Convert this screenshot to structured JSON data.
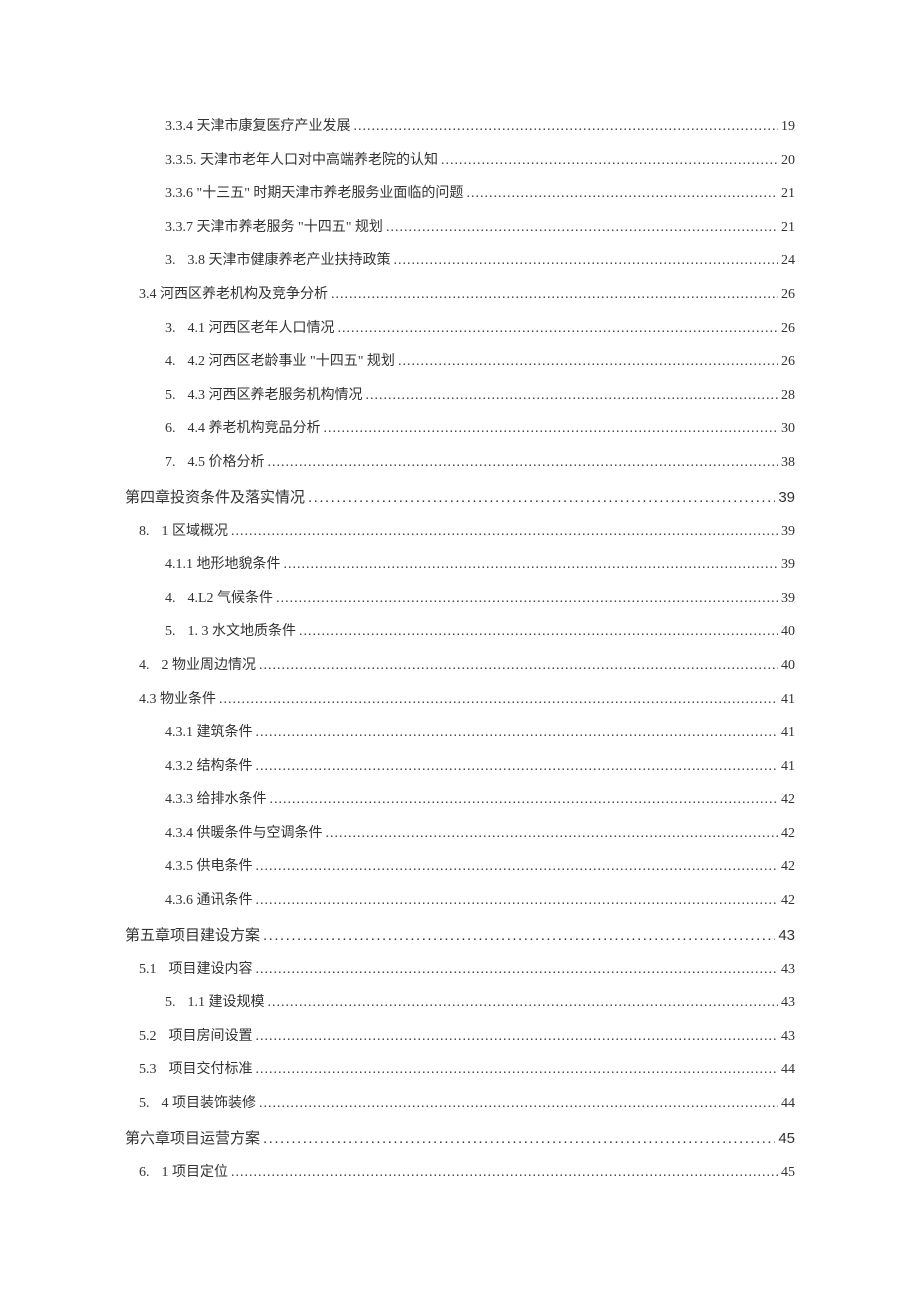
{
  "toc": [
    {
      "level": "lvl-2",
      "label": "3.3.4 天津市康复医疗产业发展",
      "page": "19"
    },
    {
      "level": "lvl-2",
      "label": "3.3.5. 天津市老年人口对中高端养老院的认知",
      "page": "20"
    },
    {
      "level": "lvl-2",
      "label": "3.3.6 \"十三五\" 时期天津市养老服务业面临的问题",
      "page": "21"
    },
    {
      "level": "lvl-2",
      "label": "3.3.7 天津市养老服务 \"十四五\" 规划",
      "page": "21"
    },
    {
      "level": "lvl-2b",
      "prefix": "3.",
      "label": "3.8 天津市健康养老产业扶持政策",
      "page": "24"
    },
    {
      "level": "lvl-1",
      "label": "3.4 河西区养老机构及竞争分析",
      "page": "26"
    },
    {
      "level": "lvl-2b",
      "prefix": "3.",
      "label": "4.1 河西区老年人口情况",
      "page": "26"
    },
    {
      "level": "lvl-2b",
      "prefix": "4.",
      "label": "4.2 河西区老龄事业 \"十四五\" 规划",
      "page": "26"
    },
    {
      "level": "lvl-2b",
      "prefix": "5.",
      "label": "4.3 河西区养老服务机构情况",
      "page": "28"
    },
    {
      "level": "lvl-2b",
      "prefix": "6.",
      "label": "4.4 养老机构竞品分析",
      "page": "30"
    },
    {
      "level": "lvl-2b",
      "prefix": "7.",
      "label": "4.5 价格分析",
      "page": "38"
    },
    {
      "level": "lvl-chapter",
      "label": "第四章投资条件及落实情况",
      "page": "39"
    },
    {
      "level": "lvl-1",
      "prefix": "8.",
      "label": "1 区域概况",
      "page": "39"
    },
    {
      "level": "lvl-2",
      "label": "4.1.1 地形地貌条件",
      "page": "39"
    },
    {
      "level": "lvl-2b",
      "prefix": "4.",
      "label": "4.L2 气候条件",
      "page": "39"
    },
    {
      "level": "lvl-2b",
      "prefix": "5.",
      "label": "1. 3 水文地质条件",
      "page": "40"
    },
    {
      "level": "lvl-1",
      "prefix": "4.",
      "label": "2 物业周边情况",
      "page": "40"
    },
    {
      "level": "lvl-1",
      "label": "4.3 物业条件",
      "page": "41"
    },
    {
      "level": "lvl-2",
      "label": "4.3.1 建筑条件",
      "page": "41"
    },
    {
      "level": "lvl-2",
      "label": "4.3.2 结构条件",
      "page": "41"
    },
    {
      "level": "lvl-2",
      "label": "4.3.3 给排水条件",
      "page": "42"
    },
    {
      "level": "lvl-2",
      "label": "4.3.4 供暖条件与空调条件",
      "page": "42"
    },
    {
      "level": "lvl-2",
      "label": "4.3.5 供电条件",
      "page": "42"
    },
    {
      "level": "lvl-2",
      "label": "4.3.6 通讯条件",
      "page": "42"
    },
    {
      "level": "lvl-chapter",
      "label": "第五章项目建设方案",
      "page": "43"
    },
    {
      "level": "lvl-1",
      "prefix": "5.1",
      "label": "项目建设内容",
      "page": "43"
    },
    {
      "level": "lvl-2b",
      "prefix": "5.",
      "label": "1.1 建设规模",
      "page": "43"
    },
    {
      "level": "lvl-1",
      "prefix": "5.2",
      "label": "项目房间设置",
      "page": "43"
    },
    {
      "level": "lvl-1",
      "prefix": "5.3",
      "label": "项目交付标准",
      "page": "44"
    },
    {
      "level": "lvl-1",
      "prefix": "5.",
      "label": "4 项目装饰装修",
      "page": "44"
    },
    {
      "level": "lvl-chapter",
      "label": "第六章项目运营方案",
      "page": "45"
    },
    {
      "level": "lvl-1",
      "prefix": "6.",
      "label": "1 项目定位",
      "page": "45"
    }
  ]
}
